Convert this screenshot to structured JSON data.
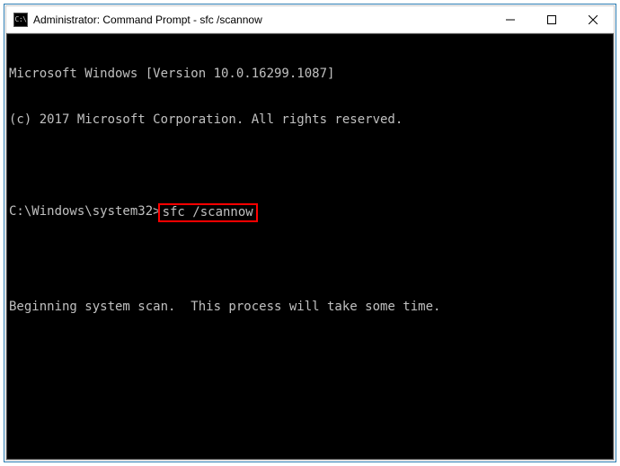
{
  "window": {
    "title": "Administrator: Command Prompt - sfc  /scannow",
    "icon_label": "cmd-icon"
  },
  "terminal": {
    "line1": "Microsoft Windows [Version 10.0.16299.1087]",
    "line2": "(c) 2017 Microsoft Corporation. All rights reserved.",
    "blank1": " ",
    "prompt_prefix": "C:\\Windows\\system32>",
    "command": "sfc /scannow",
    "blank2": " ",
    "status": "Beginning system scan.  This process will take some time."
  }
}
